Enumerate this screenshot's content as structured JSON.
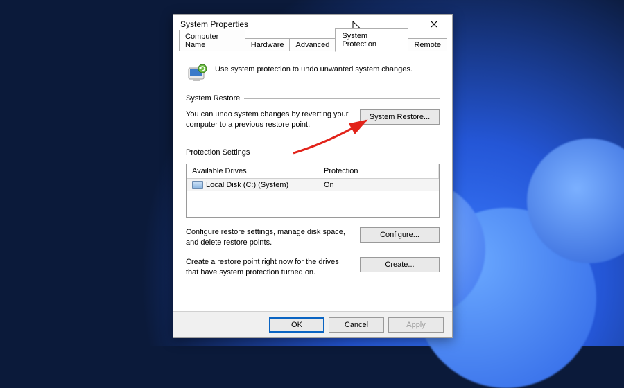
{
  "window": {
    "title": "System Properties"
  },
  "tabs": {
    "t0": "Computer Name",
    "t1": "Hardware",
    "t2": "Advanced",
    "t3": "System Protection",
    "t4": "Remote"
  },
  "intro": "Use system protection to undo unwanted system changes.",
  "groups": {
    "restore": {
      "title": "System Restore",
      "text": "You can undo system changes by reverting your computer to a previous restore point.",
      "button": "System Restore..."
    },
    "protection": {
      "title": "Protection Settings",
      "headers": {
        "drives": "Available Drives",
        "protection": "Protection"
      },
      "row": {
        "drive": "Local Disk (C:) (System)",
        "status": "On"
      },
      "configure_text": "Configure restore settings, manage disk space, and delete restore points.",
      "configure_button": "Configure...",
      "create_text": "Create a restore point right now for the drives that have system protection turned on.",
      "create_button": "Create..."
    }
  },
  "footer": {
    "ok": "OK",
    "cancel": "Cancel",
    "apply": "Apply"
  }
}
